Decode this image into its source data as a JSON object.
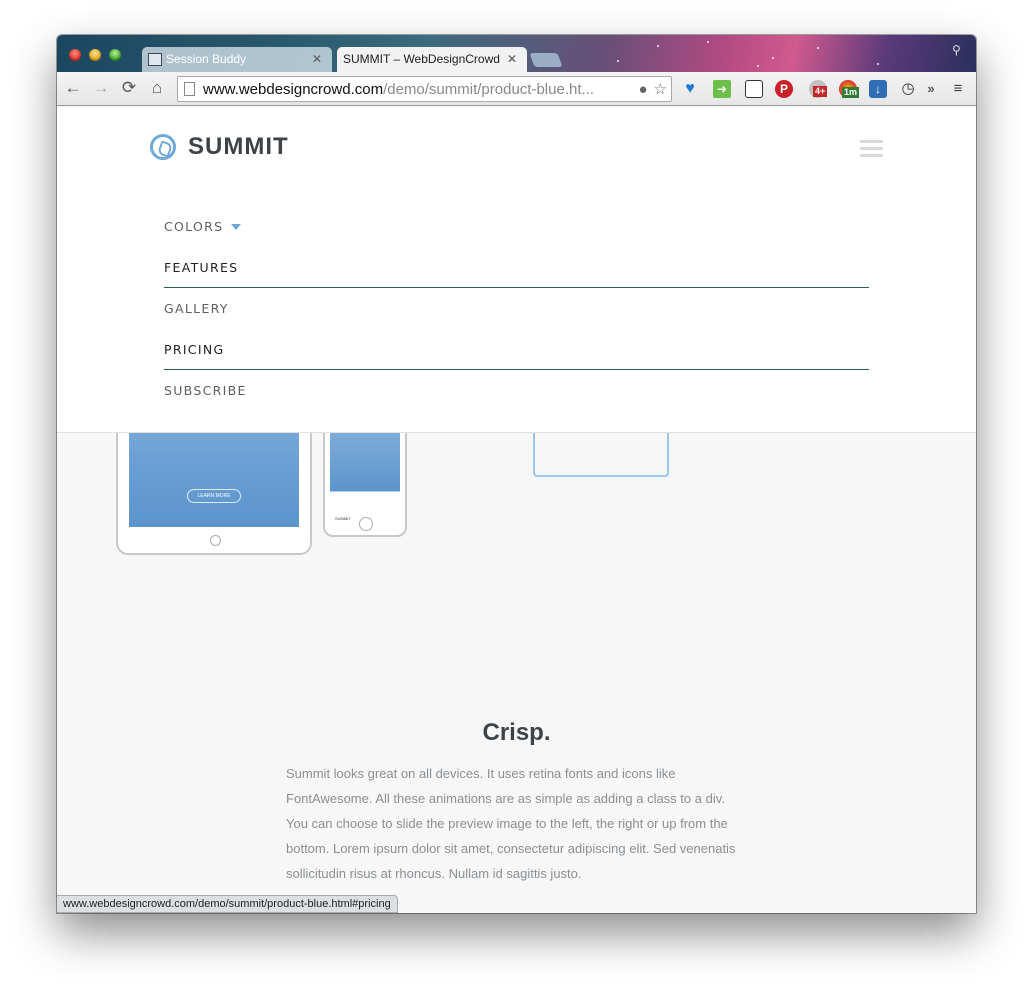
{
  "browser": {
    "tabs": [
      {
        "title": "Session Buddy",
        "active": false
      },
      {
        "title": "SUMMIT – WebDesignCrowd",
        "active": true
      }
    ],
    "url": {
      "host": "www.webdesigncrowd.com",
      "path": "/demo/summit/product-blue.ht..."
    },
    "nav": {
      "back": "←",
      "forward": "→",
      "reload": "⟳",
      "home": "⌂"
    },
    "extension_badges": {
      "weather": "4+",
      "timer": "1m"
    },
    "overflow": "»",
    "status_url": "www.webdesigncrowd.com/demo/summit/product-blue.html#pricing"
  },
  "site": {
    "logo_text": "SUMMIT",
    "menu": [
      {
        "label": "COLORS",
        "has_caret": true,
        "active": false
      },
      {
        "label": "FEATURES",
        "active": true
      },
      {
        "label": "GALLERY",
        "active": false
      },
      {
        "label": "PRICING",
        "active": true
      },
      {
        "label": "SUBSCRIBE",
        "active": false
      }
    ],
    "device_preview": {
      "learn_more": "LEARN MORE",
      "phone_brand": "SUMMIT"
    },
    "section": {
      "heading": "Crisp.",
      "body": "Summit looks great on all devices. It uses retina fonts and icons like FontAwesome. All these animations are as simple as adding a class to a div. You can choose to slide the preview image to the left, the right or up from the bottom. Lorem ipsum dolor sit amet, consectetur adipiscing elit. Sed venenatis sollicitudin risus at rhoncus. Nullam id sagittis justo."
    }
  },
  "colors": {
    "accent": "#6fa9d6",
    "active_underline": "#2d5a5c",
    "logo_text": "#3d4347"
  }
}
